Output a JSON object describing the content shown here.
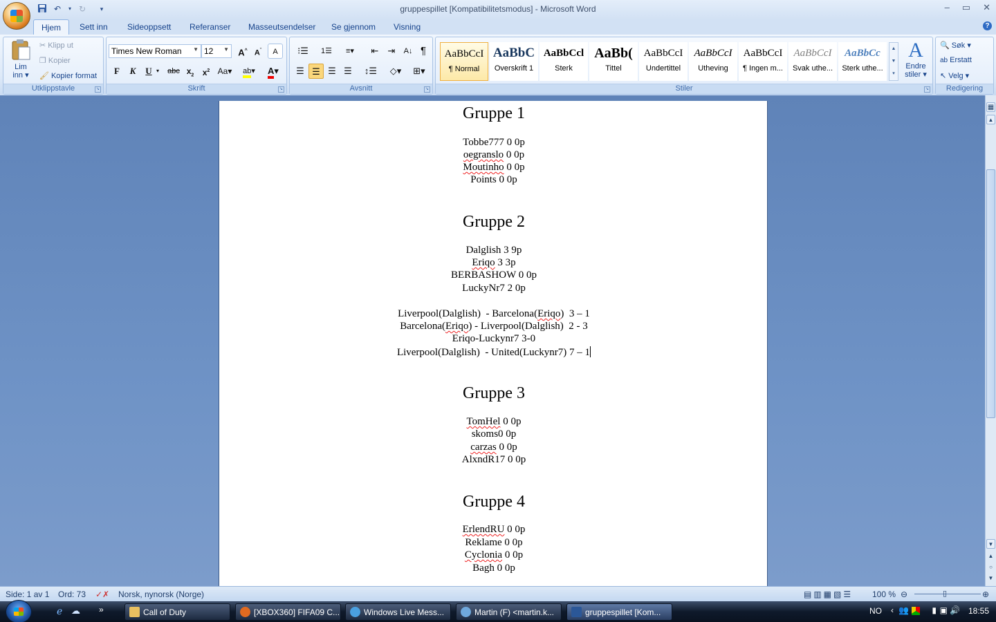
{
  "window": {
    "title": "gruppespillet [Kompatibilitetsmodus] - Microsoft Word",
    "controls": [
      "–",
      "▭",
      "✕"
    ]
  },
  "quick_access": {
    "save": "save-icon",
    "undo": "undo-icon",
    "redo": "redo-icon",
    "customize": "▾"
  },
  "ribbon_tabs": [
    "Hjem",
    "Sett inn",
    "Sideoppsett",
    "Referanser",
    "Masseutsendelser",
    "Se gjennom",
    "Visning"
  ],
  "groups": {
    "clipboard": {
      "label": "Utklippstavle",
      "paste": "Lim inn ▾",
      "cut": "Klipp ut",
      "copy": "Kopier",
      "format_painter": "Kopier format"
    },
    "font": {
      "label": "Skrift",
      "font_name": "Times New Roman",
      "font_size": "12"
    },
    "paragraph": {
      "label": "Avsnitt"
    },
    "styles": {
      "label": "Stiler",
      "items": [
        {
          "preview": "AaBbCcI",
          "name": "¶ Normal"
        },
        {
          "preview": "AaBbC",
          "name": "Overskrift 1"
        },
        {
          "preview": "AaBbCcl",
          "name": "Sterk"
        },
        {
          "preview": "AaBb(",
          "name": "Tittel"
        },
        {
          "preview": "AaBbCcI",
          "name": "Undertittel"
        },
        {
          "preview": "AaBbCcI",
          "name": "Utheving"
        },
        {
          "preview": "AaBbCcI",
          "name": "¶ Ingen m..."
        },
        {
          "preview": "AaBbCcI",
          "name": "Svak uthe..."
        },
        {
          "preview": "AaBbCc",
          "name": "Sterk uthe..."
        }
      ],
      "change_styles": "Endre stiler ▾"
    },
    "editing": {
      "label": "Redigering",
      "find": "Søk ▾",
      "replace": "Erstatt",
      "select": "Velg ▾"
    }
  },
  "document": {
    "g1_title": "Gruppe 1",
    "g1": [
      "Tobbe777 0 0p",
      "oegranslo 0 0p",
      "Moutinho 0 0p",
      "Points 0 0p"
    ],
    "g2_title": "Gruppe 2",
    "g2": [
      "Dalglish 3 9p",
      "Eriqo 3 3p",
      "BERBASHOW 0 0p",
      "LuckyNr7 2 0p"
    ],
    "g2_matches": [
      "Liverpool(Dalglish)  - Barcelona(Eriqo)  3 – 1",
      "Barcelona(Eriqo) - Liverpool(Dalglish)  2 - 3",
      "Eriqo-Luckynr7 3-0",
      "Liverpool(Dalglish)  - United(Luckynr7) 7 – 1"
    ],
    "g3_title": "Gruppe 3",
    "g3": [
      "TomHel 0 0p",
      "skoms0 0p",
      "carzas 0 0p",
      "AlxndR17 0 0p"
    ],
    "g4_title": "Gruppe 4",
    "g4": [
      "ErlendRU 0 0p",
      "Reklame 0 0p",
      "Cyclonia 0 0p",
      "Bagh 0 0p"
    ]
  },
  "statusbar": {
    "page": "Side: 1 av 1",
    "words": "Ord: 73",
    "language": "Norsk, nynorsk (Norge)",
    "zoom": "100 %"
  },
  "taskbar": {
    "items": [
      {
        "label": "Call of Duty",
        "color": "#e8c060"
      },
      {
        "label": "[XBOX360] FIFA09 C...",
        "color": "#e06a20"
      },
      {
        "label": "Windows Live Mess...",
        "color": "#4aa0e0"
      },
      {
        "label": "Martin (F) <martin.k...",
        "color": "#6fa8dc"
      },
      {
        "label": "gruppespillet [Kom...",
        "color": "#2b5797"
      }
    ],
    "lang": "NO",
    "clock": "18:55"
  }
}
